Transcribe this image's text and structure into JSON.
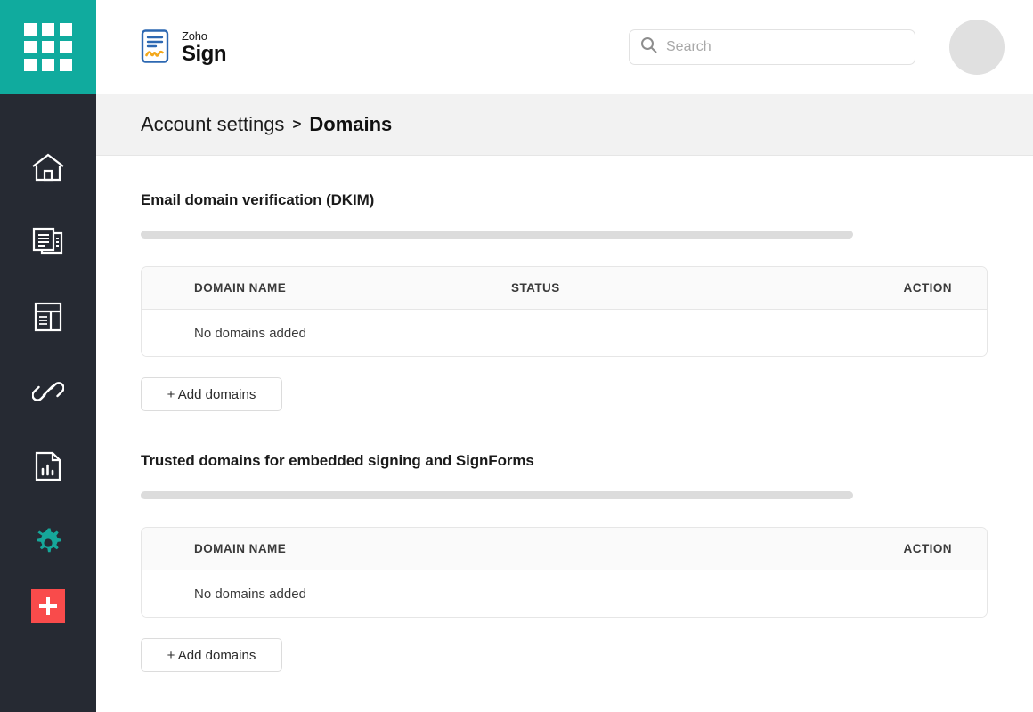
{
  "app_switcher": {
    "icon": "grid-apps-icon"
  },
  "sidebar": {
    "items": [
      {
        "icon": "home-icon",
        "name": "home"
      },
      {
        "icon": "documents-icon",
        "name": "documents"
      },
      {
        "icon": "templates-icon",
        "name": "templates"
      },
      {
        "icon": "link-icon",
        "name": "signforms"
      },
      {
        "icon": "reports-icon",
        "name": "reports"
      },
      {
        "icon": "gear-icon",
        "name": "settings",
        "active": true
      }
    ],
    "create_button": {
      "icon": "plus-icon",
      "name": "create",
      "color": "#f94b4b"
    }
  },
  "header": {
    "logo": {
      "brand": "Zoho",
      "product": "Sign",
      "icon": "zoho-sign-logo-icon"
    },
    "search": {
      "placeholder": "Search",
      "value": "",
      "icon": "search-icon"
    },
    "avatar": {
      "icon": "avatar-placeholder",
      "color": "#e0e0e0"
    }
  },
  "breadcrumb": {
    "parent": "Account settings",
    "separator": ">",
    "current": "Domains"
  },
  "sections": [
    {
      "title": "Email domain verification (DKIM)",
      "table": {
        "headers": [
          "DOMAIN NAME",
          "STATUS",
          "ACTION"
        ],
        "empty_text": "No domains added"
      },
      "add_button": "+ Add domains"
    },
    {
      "title": "Trusted domains for embedded signing and SignForms",
      "table": {
        "headers": [
          "DOMAIN NAME",
          "ACTION"
        ],
        "empty_text": "No domains added"
      },
      "add_button": "+ Add domains"
    }
  ],
  "colors": {
    "teal": "#10ab9e",
    "sidebar": "#262a33",
    "accent_red": "#f94b4b",
    "breadcrumb_bg": "#f2f2f2"
  }
}
